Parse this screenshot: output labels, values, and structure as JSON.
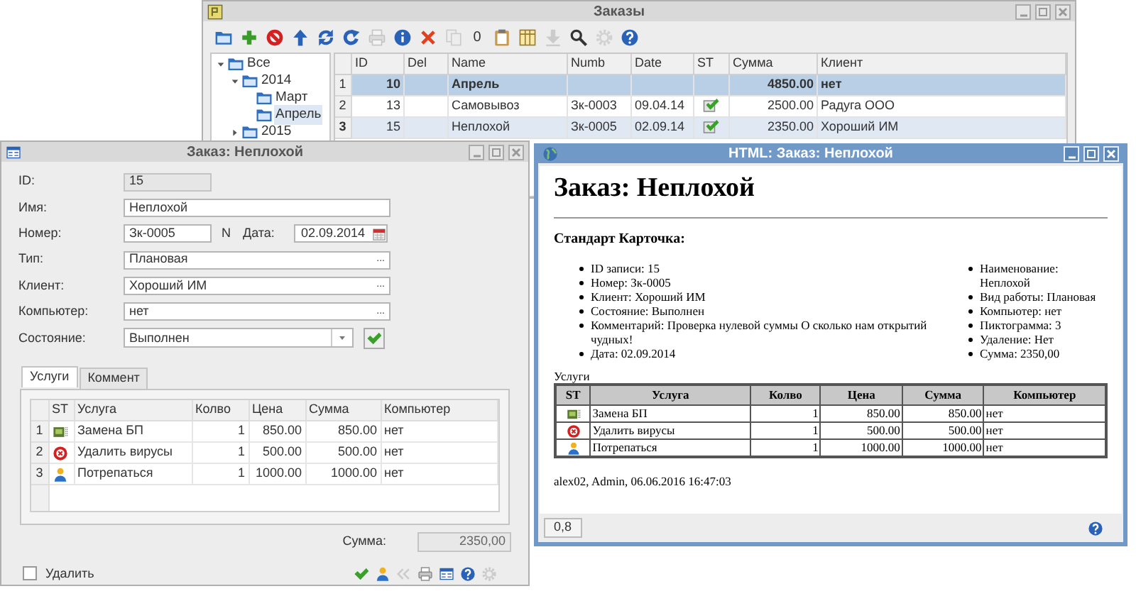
{
  "orders_window": {
    "title": "Заказы",
    "active": false,
    "toolbar": [
      {
        "kind": "folder",
        "disabled": false
      },
      {
        "kind": "add",
        "disabled": false
      },
      {
        "kind": "stop",
        "disabled": false
      },
      {
        "kind": "up",
        "disabled": false
      },
      {
        "kind": "refresh",
        "disabled": false
      },
      {
        "kind": "redo",
        "disabled": false
      },
      {
        "kind": "printer",
        "disabled": true
      },
      {
        "kind": "info",
        "disabled": false
      },
      {
        "kind": "delete",
        "disabled": false
      },
      {
        "kind": "copy",
        "disabled": true
      },
      {
        "kind": "counter",
        "label": "0"
      },
      {
        "kind": "clipboard",
        "disabled": false
      },
      {
        "kind": "table",
        "disabled": false
      },
      {
        "kind": "down",
        "disabled": true
      },
      {
        "kind": "search",
        "disabled": false
      },
      {
        "kind": "gear",
        "disabled": true
      },
      {
        "kind": "help",
        "disabled": false
      }
    ],
    "tree": [
      {
        "label": "Все",
        "expanded": true,
        "selected": false,
        "children": [
          {
            "label": "2014",
            "expanded": true,
            "selected": false,
            "children": [
              {
                "label": "Март",
                "selected": false
              },
              {
                "label": "Апрель",
                "selected": true
              }
            ]
          },
          {
            "label": "2015",
            "expanded": false,
            "selected": false
          }
        ]
      }
    ],
    "table": {
      "columns": [
        "ID",
        "Del",
        "Name",
        "Numb",
        "Date",
        "ST",
        "Сумма",
        "Клиент"
      ],
      "rows": [
        {
          "number": "1",
          "kind": "group",
          "selected": false,
          "id": "10",
          "name": "Апрель",
          "sum": "4850.00",
          "client": "нет",
          "done": false
        },
        {
          "number": "2",
          "kind": "item",
          "selected": false,
          "id": "13",
          "name": "Самовывоз",
          "numb": "Зк-0003",
          "date": "09.04.14",
          "done": true,
          "sum": "2500.00",
          "client": "Радуга ООО"
        },
        {
          "number": "3",
          "kind": "item",
          "selected": true,
          "id": "15",
          "name": "Неплохой",
          "numb": "Зк-0005",
          "date": "02.09.14",
          "done": true,
          "sum": "2350.00",
          "client": "Хороший ИМ"
        }
      ]
    }
  },
  "order_dialog": {
    "title": "Заказ: Неплохой",
    "active": false,
    "fields": [
      {
        "kind": "readonly",
        "label": "ID:",
        "value": "15"
      },
      {
        "kind": "text",
        "label": "Имя:",
        "value": "Неплохой"
      },
      {
        "kind": "number_date",
        "label": "Номер:",
        "value": "Зк-0005",
        "suffix": "N",
        "date_label": "Дата:",
        "date_value": "02.09.2014"
      },
      {
        "kind": "picker",
        "label": "Тип:",
        "value": "Плановая",
        "button": "..."
      },
      {
        "kind": "picker",
        "label": "Клиент:",
        "value": "Хороший ИМ",
        "button": "..."
      },
      {
        "kind": "picker",
        "label": "Компьютер:",
        "value": "нет",
        "button": "..."
      },
      {
        "kind": "combo",
        "label": "Состояние:",
        "value": "Выполнен"
      }
    ],
    "tabs": [
      {
        "label": "Услуги",
        "selected": true
      },
      {
        "label": "Коммент",
        "selected": false
      }
    ],
    "services": {
      "columns": [
        "ST",
        "Услуга",
        "Колво",
        "Цена",
        "Сумма",
        "Компьютер"
      ],
      "rows": [
        {
          "number": "1",
          "kind": "board",
          "name": "Замена БП",
          "qty": "1",
          "price": "850.00",
          "sum": "850.00",
          "computer": "нет"
        },
        {
          "number": "2",
          "kind": "cancel",
          "name": "Удалить вирусы",
          "qty": "1",
          "price": "500.00",
          "sum": "500.00",
          "computer": "нет"
        },
        {
          "number": "3",
          "kind": "person",
          "name": "Потрепаться",
          "qty": "1",
          "price": "1000.00",
          "sum": "1000.00",
          "computer": "нет"
        }
      ]
    },
    "total": {
      "label": "Сумма:",
      "value": "2350,00"
    },
    "delete_checkbox": {
      "label": "Удалить",
      "checked": false
    },
    "actions": [
      {
        "kind": "check",
        "disabled": false
      },
      {
        "kind": "person",
        "disabled": false
      },
      {
        "kind": "back",
        "disabled": true
      },
      {
        "kind": "printer",
        "disabled": false
      },
      {
        "kind": "window",
        "disabled": false
      },
      {
        "kind": "help",
        "disabled": false
      },
      {
        "kind": "gear",
        "disabled": true
      }
    ]
  },
  "html_window": {
    "title": "HTML: Заказ: Неплохой",
    "active": true,
    "heading": "Заказ: Неплохой",
    "subheading": "Стандарт Карточка:",
    "left_list": [
      "ID записи: 15",
      "Номер: Зк-0005",
      "Клиент: Хороший ИМ",
      "Состояние: Выполнен",
      "Комментарий: Проверка нулевой суммы О сколько нам открытий чудных!",
      "Дата: 02.09.2014"
    ],
    "right_list": [
      "Наименование: Неплохой",
      "Вид работы: Плановая",
      "Компьютер: нет",
      "Пиктограмма: 3",
      "Удаление: Нет",
      "Сумма: 2350,00"
    ],
    "table_caption": "Услуги",
    "table": {
      "columns": [
        "ST",
        "Услуга",
        "Колво",
        "Цена",
        "Сумма",
        "Компьютер"
      ],
      "rows": [
        {
          "kind": "board",
          "name": "Замена БП",
          "qty": "1",
          "price": "850.00",
          "sum": "850.00",
          "computer": "нет"
        },
        {
          "kind": "cancel",
          "name": "Удалить вирусы",
          "qty": "1",
          "price": "500.00",
          "sum": "500.00",
          "computer": "нет"
        },
        {
          "kind": "person",
          "name": "Потрепаться",
          "qty": "1",
          "price": "1000.00",
          "sum": "1000.00",
          "computer": "нет"
        }
      ]
    },
    "footer": "alex02, Admin, 06.06.2016 16:47:03",
    "zoom": "0,8"
  }
}
